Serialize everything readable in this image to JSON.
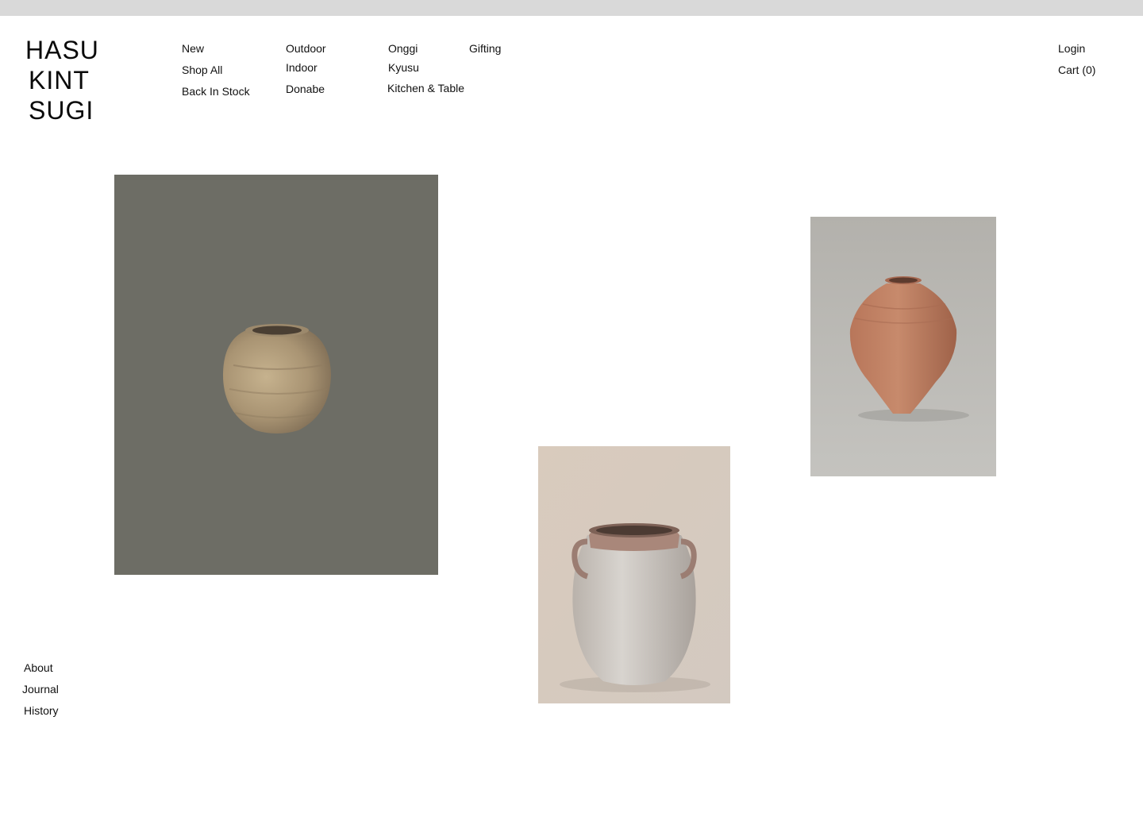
{
  "brand": {
    "line1": "HASU",
    "line2": "KINT",
    "line3": "SUGI"
  },
  "nav": {
    "col1": [
      "New",
      "Shop All",
      "Back In Stock"
    ],
    "col2": [
      "Outdoor",
      "Indoor",
      "Donabe"
    ],
    "col3": [
      "Onggi",
      "Kyusu",
      "Kitchen & Table"
    ],
    "col4": [
      "Gifting"
    ]
  },
  "account": {
    "login": "Login",
    "cart": "Cart (0)"
  },
  "footer_nav": [
    "About",
    "Journal",
    "History"
  ],
  "products": [
    {
      "icon": "round-earthen-jar-photo",
      "background": "#6d6d65"
    },
    {
      "icon": "white-handled-jar-photo",
      "background": "#d6ccc2"
    },
    {
      "icon": "terracotta-vase-photo",
      "background": "#b7b6b1"
    }
  ],
  "colors": {
    "top_strip": "#d9d9d9",
    "text": "#111111"
  }
}
